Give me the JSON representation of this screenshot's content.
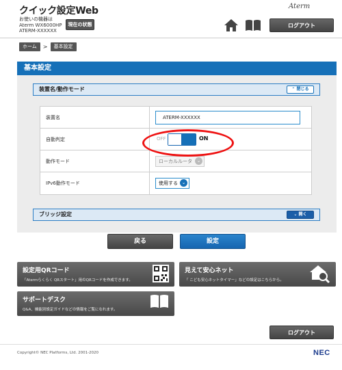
{
  "header": {
    "app_title": "クイック設定Web",
    "device_caption": "お使いの機器は",
    "model": "Aterm WX6000HP",
    "device_id": "ATERM-XXXXXX",
    "status_button": "現在の状態",
    "brand": "Aterm",
    "logout_label": "ログアウト"
  },
  "breadcrumb": {
    "home": "ホーム",
    "separator": ">",
    "current": "基本設定"
  },
  "page": {
    "title": "基本設定"
  },
  "device_section": {
    "title": "装置名/動作モード",
    "toggle_label": "閉じる",
    "rows": {
      "device_name": {
        "label": "装置名",
        "value": "ATERM-XXXXXX"
      },
      "auto_detect": {
        "label": "自動判定",
        "off_label": "OFF",
        "on_label": "ON",
        "state": "on"
      },
      "operation_mode": {
        "label": "動作モード",
        "value": "ローカルルータ"
      },
      "ipv6_mode": {
        "label": "IPv6動作モード",
        "value": "使用する"
      }
    }
  },
  "bridge_section": {
    "title": "ブリッジ設定",
    "toggle_label": "開く"
  },
  "actions": {
    "back_label": "戻る",
    "save_label": "設定"
  },
  "tiles": {
    "qr": {
      "title": "設定用QRコード",
      "desc": "「Atermらくらく QRスタート」用のQRコードを作成できます。"
    },
    "safety": {
      "title": "見えて安心ネット",
      "desc": "「 こども安心ネットタイマー」などの設定はこちらから。"
    },
    "support": {
      "title": "サポートデスク",
      "desc": "Q&A、機能別設定ガイドなどの情報をご覧になれます。"
    }
  },
  "footer": {
    "logout_label": "ログアウト",
    "copyright": "Copyright© NEC Platforms, Ltd. 2001-2020",
    "vendor": "NEC"
  },
  "colors": {
    "accent_blue": "#1670b8",
    "highlight_red": "#ee1111",
    "dark_button": "#4a4a4a"
  }
}
